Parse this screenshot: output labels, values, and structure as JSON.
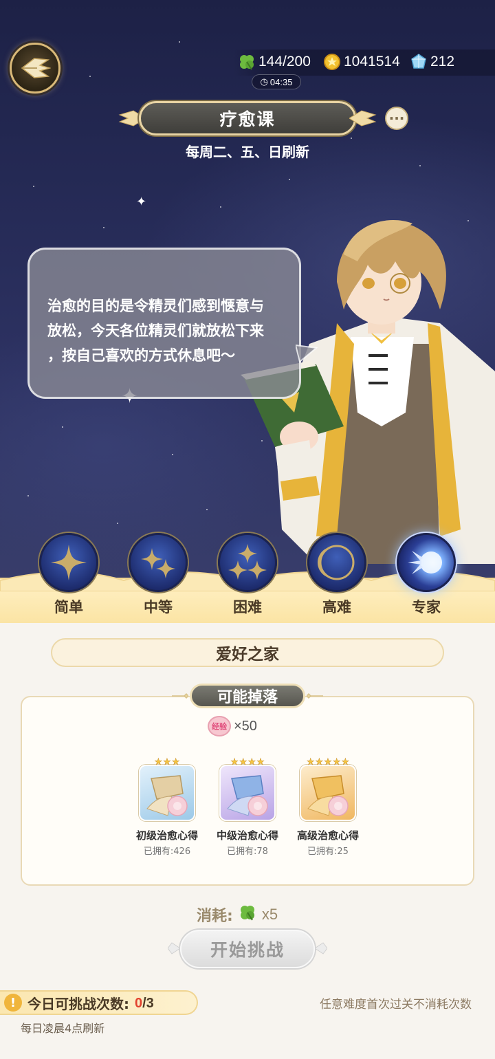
{
  "header": {
    "back_icon": "wing-back-icon",
    "resources": [
      {
        "icon": "clover-icon",
        "value": "144/200"
      },
      {
        "icon": "coin-icon",
        "value": "1041514"
      },
      {
        "icon": "crystal-icon",
        "value": "212"
      }
    ],
    "timer": "04:35",
    "title": "疗愈课",
    "more_label": "···",
    "refresh_note": "每周二、五、日刷新"
  },
  "dialog": {
    "lines": [
      "治愈的目的是令精灵们感到惬意与",
      "放松，今天各位精灵们就放松下来",
      "，按自己喜欢的方式休息吧～"
    ]
  },
  "difficulties": [
    {
      "label": "简单",
      "active": false
    },
    {
      "label": "中等",
      "active": false
    },
    {
      "label": "困难",
      "active": false
    },
    {
      "label": "高难",
      "active": false
    },
    {
      "label": "专家",
      "active": true
    }
  ],
  "stage": {
    "name": "爱好之家"
  },
  "drops": {
    "title": "可能掉落",
    "exp": {
      "badge": "经验",
      "amount": "×50"
    },
    "items": [
      {
        "name": "初级治愈心得",
        "owned": "已拥有:426",
        "stars": 3,
        "color": "#bcd9ee"
      },
      {
        "name": "中级治愈心得",
        "owned": "已拥有:78",
        "stars": 4,
        "color": "#d3c2ee"
      },
      {
        "name": "高级治愈心得",
        "owned": "已拥有:25",
        "stars": 5,
        "color": "#f6d59a"
      }
    ]
  },
  "cost": {
    "label": "消耗:",
    "icon": "clover-icon",
    "value": "x5"
  },
  "start_button": "开始挑战",
  "daily": {
    "label": "今日可挑战次数:",
    "current": "0",
    "total": "/3",
    "refresh": "每日凌晨4点刷新",
    "first_clear_note": "任意难度首次过关不消耗次数"
  },
  "colors": {
    "accent_gold": "#e8d4a4",
    "night_sky": "#262b57",
    "panel": "#f7f4ef",
    "count_red": "#e2422e"
  }
}
